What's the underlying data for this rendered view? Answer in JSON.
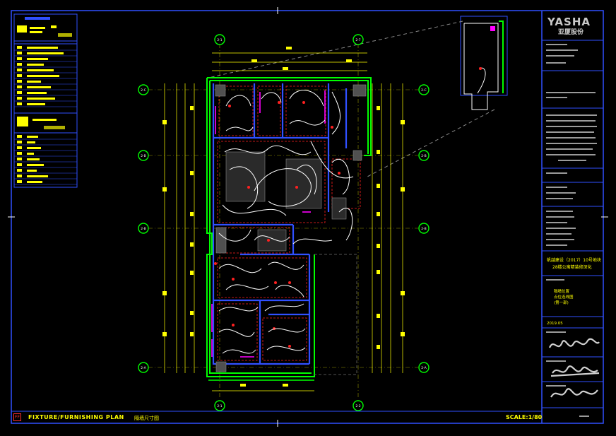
{
  "drawing": {
    "title": "FIXTURE/FURNISHING PLAN",
    "subtitle": "隔墙尺寸图",
    "scale": "SCALE:1/80",
    "ff_tag": "FF"
  },
  "title_block": {
    "logo": "YASHA",
    "logo_cn": "亚厦股份",
    "project_line1": "帆越建设（2017）10号地块",
    "project_line2": "28楼公寓精装修深化",
    "drawing_name_1": "隔墙位置",
    "drawing_name_2": "点位连线图",
    "drawing_name_3": "(第一部)",
    "date": "2019.05"
  },
  "grid_labels": {
    "top": [
      "2-1",
      "2-7"
    ],
    "bottom": [
      "2-1",
      "2-2"
    ],
    "left": [
      "2-C",
      "2-B",
      "2-B",
      "2-A"
    ],
    "right": [
      "2-C",
      "2-B",
      "2-B",
      "2-A"
    ]
  },
  "colors": {
    "wall_green": "#00ff00",
    "dimension_yellow": "#ffff00",
    "wiring_white": "#ffffff",
    "fixture_red": "#ff2020",
    "magenta": "#ff00ff",
    "frame_blue": "#2040ff"
  }
}
